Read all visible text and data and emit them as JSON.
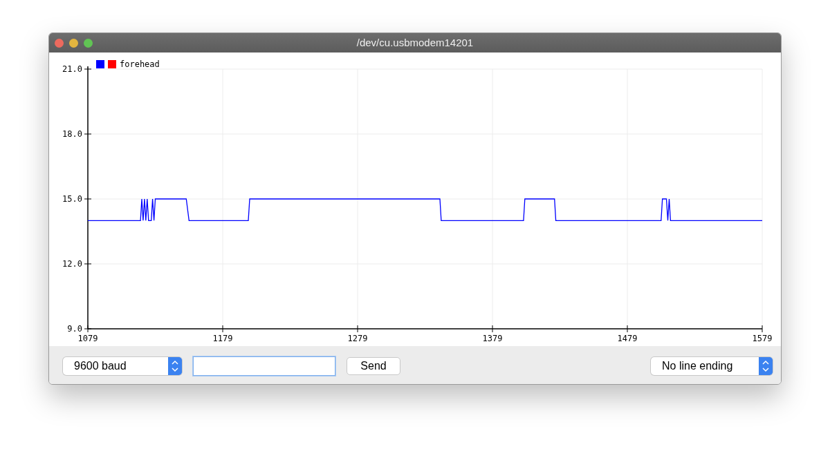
{
  "window": {
    "title": "/dev/cu.usbmodem14201"
  },
  "plot": {
    "legend": {
      "swatches": [
        {
          "color": "#0000ff"
        },
        {
          "color": "#ff0000"
        }
      ]
    },
    "chart_data": {
      "type": "line",
      "grid": true,
      "x": [
        1079,
        1118,
        1119,
        1120,
        1121,
        1122,
        1123,
        1124,
        1126,
        1127,
        1128,
        1129,
        1152,
        1154,
        1198,
        1199,
        1340,
        1341,
        1402,
        1403,
        1425,
        1426,
        1504,
        1505,
        1508,
        1509,
        1510,
        1511,
        1579
      ],
      "series": [
        {
          "name": "forehead",
          "color": "#0000ff",
          "values": [
            14,
            14,
            15,
            14,
            15,
            14,
            15,
            14,
            14,
            15,
            14,
            15,
            15,
            14,
            14,
            15,
            15,
            14,
            14,
            15,
            15,
            14,
            14,
            15,
            15,
            14,
            15,
            14,
            14
          ]
        }
      ],
      "xlim": [
        1079,
        1579
      ],
      "ylim": [
        9,
        21
      ],
      "xticks": [
        1079,
        1179,
        1279,
        1379,
        1479,
        1579
      ],
      "yticks": [
        {
          "value": 9,
          "label": "9.0"
        },
        {
          "value": 12,
          "label": "12.0"
        },
        {
          "value": 15,
          "label": "15.0"
        },
        {
          "value": 18,
          "label": "18.0"
        },
        {
          "value": 21,
          "label": "21.0"
        }
      ]
    }
  },
  "controls": {
    "baud": "9600 baud",
    "message": {
      "focused": true
    },
    "send": "Send",
    "line_ending": "No line ending"
  }
}
